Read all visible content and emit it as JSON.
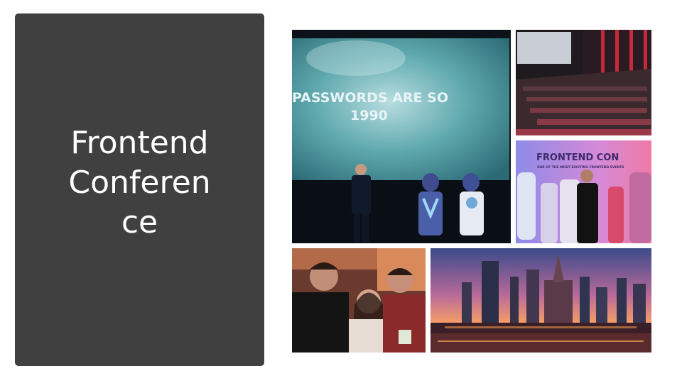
{
  "slide": {
    "title_lines": [
      "Frontend",
      "Conferen",
      "ce"
    ],
    "panel_color": "#404040",
    "title_color": "#ffffff"
  },
  "photos": {
    "stage": {
      "screen_text_line1": "PASSWORDS ARE SO",
      "screen_text_line2": "1990"
    },
    "auditorium": {},
    "banner": {
      "heading": "FRONTEND CON",
      "tagline": "ONE OF THE MOST EXCITING FRONTEND EVENTS"
    },
    "selfie": {},
    "skyline": {}
  }
}
